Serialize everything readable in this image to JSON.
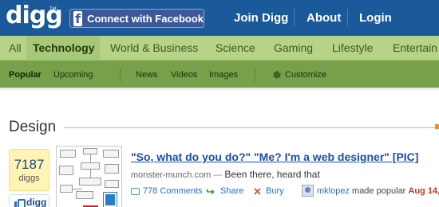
{
  "topbar": {
    "logo": "digg",
    "logo_tm": "TM",
    "facebook_icon_glyph": "f",
    "facebook_button": "Connect with Facebook",
    "links": [
      "Join Digg",
      "About",
      "Login"
    ],
    "background": "#1a5a9b"
  },
  "categories": {
    "items": [
      "All",
      "Technology",
      "World & Business",
      "Science",
      "Gaming",
      "Lifestyle",
      "Entertain"
    ],
    "active": "Technology"
  },
  "subnav": {
    "items": [
      "Popular",
      "Upcoming",
      "News",
      "Videos",
      "Images",
      "Customize"
    ],
    "active": "Popular",
    "customize_icon": "gear-icon"
  },
  "section": {
    "title": "Design"
  },
  "story": {
    "digg_count": "7187",
    "digg_count_label": "diggs",
    "digg_button": "digg",
    "title": "\"So, what do you do?\" \"Me? I'm a web designer\" [PIC]",
    "source": "monster-munch.com",
    "separator": "—",
    "description": "Been there, heard that",
    "comments": "778 Comments",
    "share": "Share",
    "bury": "Bury",
    "username": "mklopez",
    "made_popular": "made popular",
    "date": "Aug 14,"
  },
  "colors": {
    "category_bar": "#b6d387",
    "sub_bar": "#77a04a",
    "digg_box": "#fff4b3",
    "link": "#1a4fa8"
  }
}
